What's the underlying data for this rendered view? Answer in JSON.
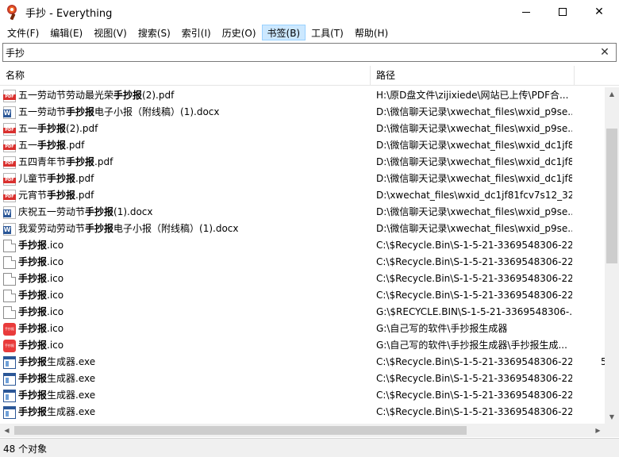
{
  "window": {
    "title": "手抄 - Everything",
    "minimize": "—",
    "close": "✕"
  },
  "menu": [
    {
      "label": "文件(F)"
    },
    {
      "label": "编辑(E)"
    },
    {
      "label": "视图(V)"
    },
    {
      "label": "搜索(S)"
    },
    {
      "label": "索引(I)"
    },
    {
      "label": "历史(O)"
    },
    {
      "label": "书签(B)",
      "active": true
    },
    {
      "label": "工具(T)"
    },
    {
      "label": "帮助(H)"
    }
  ],
  "search": {
    "value": "手抄",
    "clear_icon": "close-icon"
  },
  "columns": {
    "name": "名称",
    "path": "路径"
  },
  "files": [
    {
      "icon": "pdf",
      "pre": "五一劳动节劳动最光荣",
      "bold": "手抄报",
      "post": "(2).pdf",
      "path": "H:\\原D盘文件\\zijixiede\\网站已上传\\PDF合..."
    },
    {
      "icon": "docx",
      "pre": "五一劳动节",
      "bold": "手抄报",
      "post": "电子小报（附线稿）(1).docx",
      "path": "D:\\微信聊天记录\\xwechat_files\\wxid_p9se..."
    },
    {
      "icon": "pdf",
      "pre": "五一",
      "bold": "手抄报",
      "post": "(2).pdf",
      "path": "D:\\微信聊天记录\\xwechat_files\\wxid_p9se..."
    },
    {
      "icon": "pdf",
      "pre": "五一",
      "bold": "手抄报",
      "post": ".pdf",
      "path": "D:\\微信聊天记录\\xwechat_files\\wxid_dc1jf8..."
    },
    {
      "icon": "pdf",
      "pre": "五四青年节",
      "bold": "手抄报",
      "post": ".pdf",
      "path": "D:\\微信聊天记录\\xwechat_files\\wxid_dc1jf8..."
    },
    {
      "icon": "pdf",
      "pre": "儿童节",
      "bold": "手抄报",
      "post": ".pdf",
      "path": "D:\\微信聊天记录\\xwechat_files\\wxid_dc1jf8..."
    },
    {
      "icon": "pdf",
      "pre": "元宵节",
      "bold": "手抄报",
      "post": ".pdf",
      "path": "D:\\xwechat_files\\wxid_dc1jf81fcv7s12_324..."
    },
    {
      "icon": "docx",
      "pre": "庆祝五一劳动节",
      "bold": "手抄报",
      "post": "(1).docx",
      "path": "D:\\微信聊天记录\\xwechat_files\\wxid_p9se..."
    },
    {
      "icon": "docx",
      "pre": "我爱劳动劳动节",
      "bold": "手抄报",
      "post": "电子小报（附线稿）(1).docx",
      "path": "D:\\微信聊天记录\\xwechat_files\\wxid_p9se..."
    },
    {
      "icon": "blank",
      "pre": "",
      "bold": "手抄报",
      "post": ".ico",
      "path": "C:\\$Recycle.Bin\\S-1-5-21-3369548306-22..."
    },
    {
      "icon": "blank",
      "pre": "",
      "bold": "手抄报",
      "post": ".ico",
      "path": "C:\\$Recycle.Bin\\S-1-5-21-3369548306-22..."
    },
    {
      "icon": "blank",
      "pre": "",
      "bold": "手抄报",
      "post": ".ico",
      "path": "C:\\$Recycle.Bin\\S-1-5-21-3369548306-22..."
    },
    {
      "icon": "blank",
      "pre": "",
      "bold": "手抄报",
      "post": ".ico",
      "path": "C:\\$Recycle.Bin\\S-1-5-21-3369548306-22..."
    },
    {
      "icon": "blank",
      "pre": "",
      "bold": "手抄报",
      "post": ".ico",
      "path": "G:\\$RECYCLE.BIN\\S-1-5-21-3369548306-..."
    },
    {
      "icon": "app",
      "pre": "",
      "bold": "手抄报",
      "post": ".ico",
      "path": "G:\\自己写的软件\\手抄报生成器"
    },
    {
      "icon": "app",
      "pre": "",
      "bold": "手抄报",
      "post": ".ico",
      "path": "G:\\自己写的软件\\手抄报生成器\\手抄报生成..."
    },
    {
      "icon": "exe",
      "pre": "",
      "bold": "手抄报",
      "post": "生成器.exe",
      "path": "C:\\$Recycle.Bin\\S-1-5-21-3369548306-22...",
      "extra": "5"
    },
    {
      "icon": "exe",
      "pre": "",
      "bold": "手抄报",
      "post": "生成器.exe",
      "path": "C:\\$Recycle.Bin\\S-1-5-21-3369548306-22..."
    },
    {
      "icon": "exe",
      "pre": "",
      "bold": "手抄报",
      "post": "生成器.exe",
      "path": "C:\\$Recycle.Bin\\S-1-5-21-3369548306-22..."
    },
    {
      "icon": "exe",
      "pre": "",
      "bold": "手抄报",
      "post": "生成器.exe",
      "path": "C:\\$Recycle.Bin\\S-1-5-21-3369548306-22..."
    }
  ],
  "icon_glyphs": {
    "pdf": "PDF",
    "docx": "W",
    "app": "手抄报"
  },
  "status": {
    "text": "48 个对象"
  },
  "scroll": {
    "up": "▲",
    "down": "▼",
    "left": "◀",
    "right": "▶"
  }
}
